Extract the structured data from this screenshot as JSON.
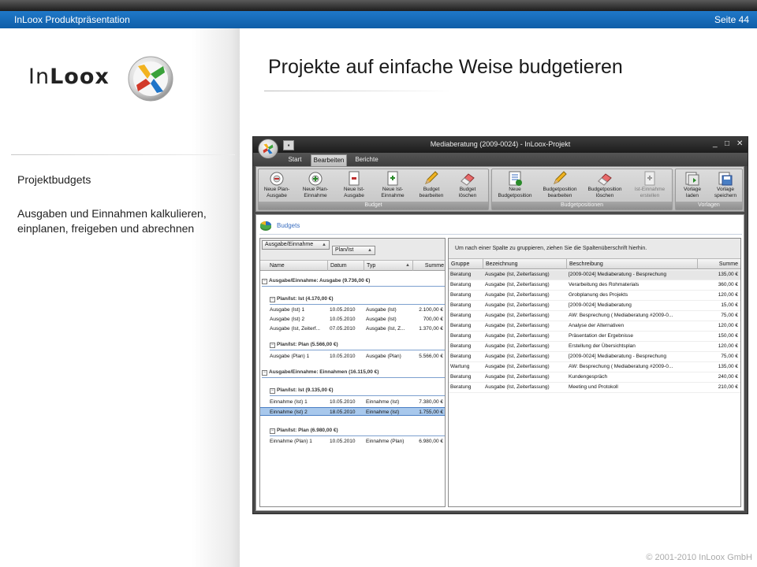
{
  "slide": {
    "presentation_title": "InLoox Produktpräsentation",
    "page_number": "Seite 44",
    "title": "Projekte auf einfache Weise budgetieren",
    "logo_in": "In",
    "logo_loox": "Loox",
    "sidebar_heading": "Projektbudgets",
    "sidebar_text": "Ausgaben und Einnahmen kalkulieren, einplanen, freigeben und abrechnen",
    "copyright": "© 2001-2010 InLoox GmbH"
  },
  "colors": {
    "accent_blue": "#1270c0",
    "header_dark": "#2a2a2a",
    "selection": "#a8c8ec"
  },
  "window": {
    "title": "Mediaberatung (2009-0024) - InLoox-Projekt",
    "quick_access_icon": "save-icon",
    "controls": {
      "minimize": "_",
      "maximize": "□",
      "close": "✕"
    },
    "tabs": [
      "Start",
      "Bearbeiten",
      "Berichte"
    ],
    "active_tab": "Bearbeiten"
  },
  "ribbon": {
    "groups": [
      {
        "label": "Budget",
        "buttons": [
          {
            "line1": "Neue Plan-",
            "line2": "Ausgabe",
            "icon": "plan-expense-icon"
          },
          {
            "line1": "Neue Plan-",
            "line2": "Einnahme",
            "icon": "plan-income-icon"
          },
          {
            "line1": "Neue Ist-",
            "line2": "Ausgabe",
            "icon": "actual-expense-icon"
          },
          {
            "line1": "Neue Ist-",
            "line2": "Einnahme",
            "icon": "actual-income-icon"
          },
          {
            "line1": "Budget",
            "line2": "bearbeiten",
            "icon": "pencil-icon"
          },
          {
            "line1": "Budget",
            "line2": "löschen",
            "icon": "eraser-icon"
          }
        ]
      },
      {
        "label": "Budgetpositionen",
        "buttons": [
          {
            "line1": "Neue",
            "line2": "Budgetposition",
            "icon": "new-position-icon"
          },
          {
            "line1": "Budgetposition",
            "line2": "bearbeiten",
            "icon": "pencil-icon"
          },
          {
            "line1": "Budgetposition",
            "line2": "löschen",
            "icon": "eraser-icon"
          },
          {
            "line1": "Ist-Einnahme",
            "line2": "erstellen",
            "icon": "create-actual-income-icon"
          }
        ]
      },
      {
        "label": "Vorlagen",
        "buttons": [
          {
            "line1": "Vorlage",
            "line2": "laden",
            "icon": "template-load-icon"
          },
          {
            "line1": "Vorlage",
            "line2": "speichern",
            "icon": "template-save-icon"
          }
        ]
      }
    ]
  },
  "budgets": {
    "title": "Budgets",
    "group_chips": [
      "Ausgabe/Einnahme",
      "Plan/Ist"
    ],
    "columns": [
      "Name",
      "Datum",
      "Typ",
      "Summe"
    ],
    "rows": [
      {
        "kind": "group1",
        "text": "Ausgabe/Einnahme: Ausgabe (9.736,00 €)"
      },
      {
        "kind": "group2",
        "text": "Plan/Ist: Ist (4.170,00 €)"
      },
      {
        "kind": "row",
        "name": "Ausgabe (Ist) 1",
        "date": "10.05.2010",
        "type": "Ausgabe (Ist)",
        "sum": "2.100,00 €"
      },
      {
        "kind": "row",
        "name": "Ausgabe (Ist) 2",
        "date": "10.05.2010",
        "type": "Ausgabe (Ist)",
        "sum": "700,00 €"
      },
      {
        "kind": "row",
        "name": "Ausgabe (Ist, Zeiterf...",
        "date": "07.05.2010",
        "type": "Ausgabe (Ist, Z...",
        "sum": "1.370,00 €"
      },
      {
        "kind": "group2",
        "text": "Plan/Ist: Plan (5.566,00 €)"
      },
      {
        "kind": "row",
        "name": "Ausgabe (Plan) 1",
        "date": "10.05.2010",
        "type": "Ausgabe (Plan)",
        "sum": "5.566,00 €"
      },
      {
        "kind": "group1",
        "text": "Ausgabe/Einnahme: Einnahmen (16.115,00 €)"
      },
      {
        "kind": "group2",
        "text": "Plan/Ist: Ist (9.135,00 €)"
      },
      {
        "kind": "row",
        "name": "Einnahme (Ist) 1",
        "date": "10.05.2010",
        "type": "Einnahme (Ist)",
        "sum": "7.380,00 €"
      },
      {
        "kind": "row",
        "name": "Einnahme (Ist) 2",
        "date": "18.05.2010",
        "type": "Einnahme (Ist)",
        "sum": "1.755,00 €",
        "selected": true
      },
      {
        "kind": "group2",
        "text": "Plan/Ist: Plan (6.980,00 €)"
      },
      {
        "kind": "row",
        "name": "Einnahme (Plan) 1",
        "date": "10.05.2010",
        "type": "Einnahme (Plan)",
        "sum": "6.980,00 €"
      }
    ]
  },
  "positions": {
    "group_hint": "Um nach einer Spalte zu gruppieren, ziehen Sie die Spaltenüberschrift hierhin.",
    "columns": [
      "Gruppe",
      "Bezeichnung",
      "Beschreibung",
      "Summe"
    ],
    "rows": [
      {
        "group": "Beratung",
        "name": "Ausgabe (Ist, Zeiterfassung)",
        "desc": "[2009-0024] Mediaberatung - Besprechung",
        "sum": "135,00 €"
      },
      {
        "group": "Beratung",
        "name": "Ausgabe (Ist, Zeiterfassung)",
        "desc": "Verarbeitung des Rohmaterials",
        "sum": "360,00 €"
      },
      {
        "group": "Beratung",
        "name": "Ausgabe (Ist, Zeiterfassung)",
        "desc": "Grobplanung des Projekts",
        "sum": "120,00 €"
      },
      {
        "group": "Beratung",
        "name": "Ausgabe (Ist, Zeiterfassung)",
        "desc": "[2009-0024] Mediaberatung",
        "sum": "15,00 €"
      },
      {
        "group": "Beratung",
        "name": "Ausgabe (Ist, Zeiterfassung)",
        "desc": "AW: Besprechung  ( Mediaberatung #2009-0...",
        "sum": "75,00 €"
      },
      {
        "group": "Beratung",
        "name": "Ausgabe (Ist, Zeiterfassung)",
        "desc": "Analyse der Alternativen",
        "sum": "120,00 €"
      },
      {
        "group": "Beratung",
        "name": "Ausgabe (Ist, Zeiterfassung)",
        "desc": "Präsentation der Ergebnisse",
        "sum": "150,00 €"
      },
      {
        "group": "Beratung",
        "name": "Ausgabe (Ist, Zeiterfassung)",
        "desc": "Erstellung der Übersichtsplan",
        "sum": "120,00 €"
      },
      {
        "group": "Beratung",
        "name": "Ausgabe (Ist, Zeiterfassung)",
        "desc": "[2009-0024] Mediaberatung - Besprechung",
        "sum": "75,00 €"
      },
      {
        "group": "Wartung",
        "name": "Ausgabe (Ist, Zeiterfassung)",
        "desc": "AW: Besprechung  ( Mediaberatung #2009-0...",
        "sum": "135,00 €"
      },
      {
        "group": "Beratung",
        "name": "Ausgabe (Ist, Zeiterfassung)",
        "desc": "Kundengespräch",
        "sum": "240,00 €"
      },
      {
        "group": "Beratung",
        "name": "Ausgabe (Ist, Zeiterfassung)",
        "desc": "Meeting und Protokoll",
        "sum": "210,00 €"
      }
    ]
  }
}
